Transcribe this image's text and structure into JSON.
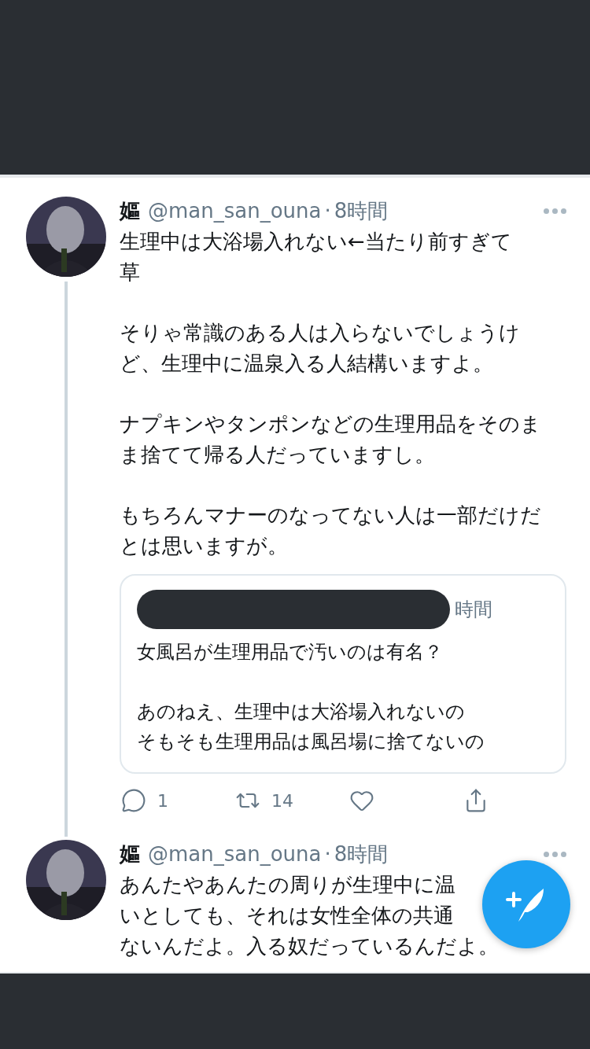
{
  "tweets": [
    {
      "display_name": "嫗",
      "handle": "@man_san_ouna",
      "separator": "·",
      "time": "8時間",
      "thread_line": true,
      "paragraphs": [
        [
          "生理中は大浴場入れない←当たり前すぎて",
          "草"
        ],
        [
          "そりゃ常識のある人は入らないでしょうけ",
          "ど、生理中に温泉入る人結構いますよ。"
        ],
        [
          "ナプキンやタンポンなどの生理用品をそのま",
          "ま捨てて帰る人だっていますし。"
        ],
        [
          "もちろんマナーのなってない人は一部だけだ",
          "とは思いますが。"
        ]
      ],
      "quote": {
        "redacted": true,
        "time": "時間",
        "paragraphs": [
          [
            "女風呂が生理用品で汚いのは有名？"
          ],
          [
            "あのねえ、生理中は大浴場入れないの",
            "そもそも生理用品は風呂場に捨てないの"
          ]
        ]
      },
      "actions": [
        {
          "kind": "reply",
          "count": "1"
        },
        {
          "kind": "retweet",
          "count": "14"
        },
        {
          "kind": "like"
        },
        {
          "kind": "share"
        }
      ]
    },
    {
      "display_name": "嫗",
      "handle": "@man_san_ouna",
      "separator": "·",
      "time": "8時間",
      "thread_line": false,
      "paragraphs": [
        [
          "あんたやあんたの周りが生理中に温",
          "いとしても、それは女性全体の共通",
          "ないんだよ。入る奴だっているんだよ。"
        ]
      ]
    }
  ]
}
